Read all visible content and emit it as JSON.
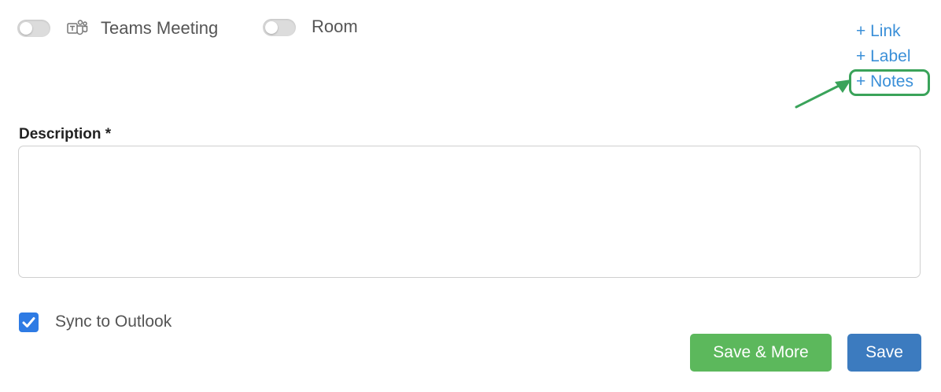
{
  "toggles": [
    {
      "label": "Teams Meeting",
      "on": false,
      "icon": "teams-icon"
    },
    {
      "label": "Room",
      "on": false
    }
  ],
  "links": {
    "link": "+ Link",
    "label": "+ Label",
    "notes": "+ Notes"
  },
  "description": {
    "label": "Description *",
    "value": ""
  },
  "sync": {
    "label": "Sync to Outlook",
    "checked": true
  },
  "buttons": {
    "save_more": "Save & More",
    "save": "Save"
  },
  "colors": {
    "link": "#3a8fd8",
    "highlight": "#3aa35a",
    "checkbox": "#2e7be4",
    "save_more_bg": "#5cb85c",
    "save_bg": "#3c7bbf"
  }
}
